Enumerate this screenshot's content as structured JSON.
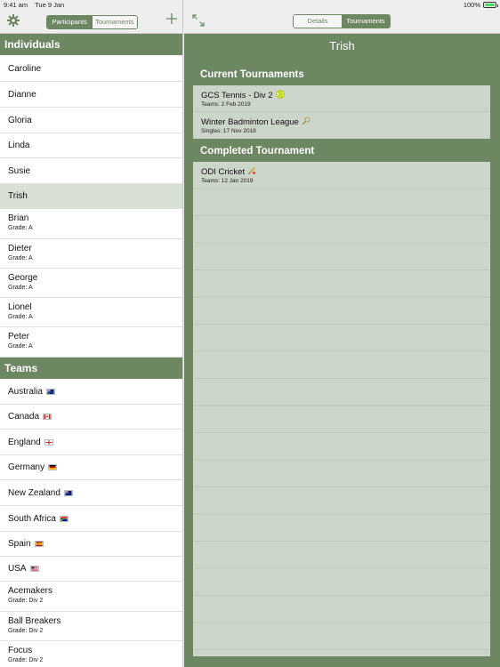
{
  "status": {
    "time": "9:41 am",
    "date": "Tue 9 Jan",
    "battery": "100%",
    "battery_level": 1.0
  },
  "left_nav": {
    "segments": [
      {
        "label": "Participants",
        "active": true
      },
      {
        "label": "Tournaments",
        "active": false
      }
    ],
    "settings_icon": "gear-icon",
    "add_icon": "plus-icon"
  },
  "individuals": {
    "header": "Individuals",
    "items": [
      {
        "name": "Caroline",
        "grade": ""
      },
      {
        "name": "Dianne",
        "grade": ""
      },
      {
        "name": "Gloria",
        "grade": ""
      },
      {
        "name": "Linda",
        "grade": ""
      },
      {
        "name": "Susie",
        "grade": ""
      },
      {
        "name": "Trish",
        "grade": "",
        "selected": true
      },
      {
        "name": "Brian",
        "grade": "Grade: A"
      },
      {
        "name": "Dieter",
        "grade": "Grade: A"
      },
      {
        "name": "George",
        "grade": "Grade: A"
      },
      {
        "name": "Lionel",
        "grade": "Grade: A"
      },
      {
        "name": "Peter",
        "grade": "Grade: A"
      }
    ]
  },
  "teams": {
    "header": "Teams",
    "items": [
      {
        "name": "Australia",
        "flag": "australia-flag-icon",
        "grade": ""
      },
      {
        "name": "Canada",
        "flag": "canada-flag-icon",
        "grade": ""
      },
      {
        "name": "England",
        "flag": "england-flag-icon",
        "grade": ""
      },
      {
        "name": "Germany",
        "flag": "germany-flag-icon",
        "grade": ""
      },
      {
        "name": "New Zealand",
        "flag": "new-zealand-flag-icon",
        "grade": ""
      },
      {
        "name": "South Africa",
        "flag": "south-africa-flag-icon",
        "grade": ""
      },
      {
        "name": "Spain",
        "flag": "spain-flag-icon",
        "grade": ""
      },
      {
        "name": "USA",
        "flag": "usa-flag-icon",
        "grade": ""
      },
      {
        "name": "Acemakers",
        "grade": "Grade: Div 2"
      },
      {
        "name": "Ball Breakers",
        "grade": "Grade: Div 2"
      },
      {
        "name": "Focus",
        "grade": "Grade: Div 2"
      }
    ]
  },
  "right_nav": {
    "expand_icon": "expand-arrows-icon",
    "segments": [
      {
        "label": "Details",
        "active": false
      },
      {
        "label": "Tournaments",
        "active": true
      }
    ]
  },
  "detail": {
    "title": "Trish",
    "current_header": "Current Tournaments",
    "current": [
      {
        "name": "GCS Tennis - Div 2",
        "icon": "tennis-ball-icon",
        "sub": "Teams: 2 Feb 2019"
      },
      {
        "name": "Winter Badminton League",
        "icon": "badminton-icon",
        "sub": "Singles: 17 Nov 2018"
      }
    ],
    "completed_header": "Completed Tournament",
    "completed": [
      {
        "name": "ODI Cricket",
        "icon": "cricket-icon",
        "sub": "Teams: 12 Jan 2019"
      }
    ]
  },
  "colors": {
    "accent": "#6d8763",
    "selected_row": "#d8e0d6",
    "card": "#ccd5c9"
  }
}
